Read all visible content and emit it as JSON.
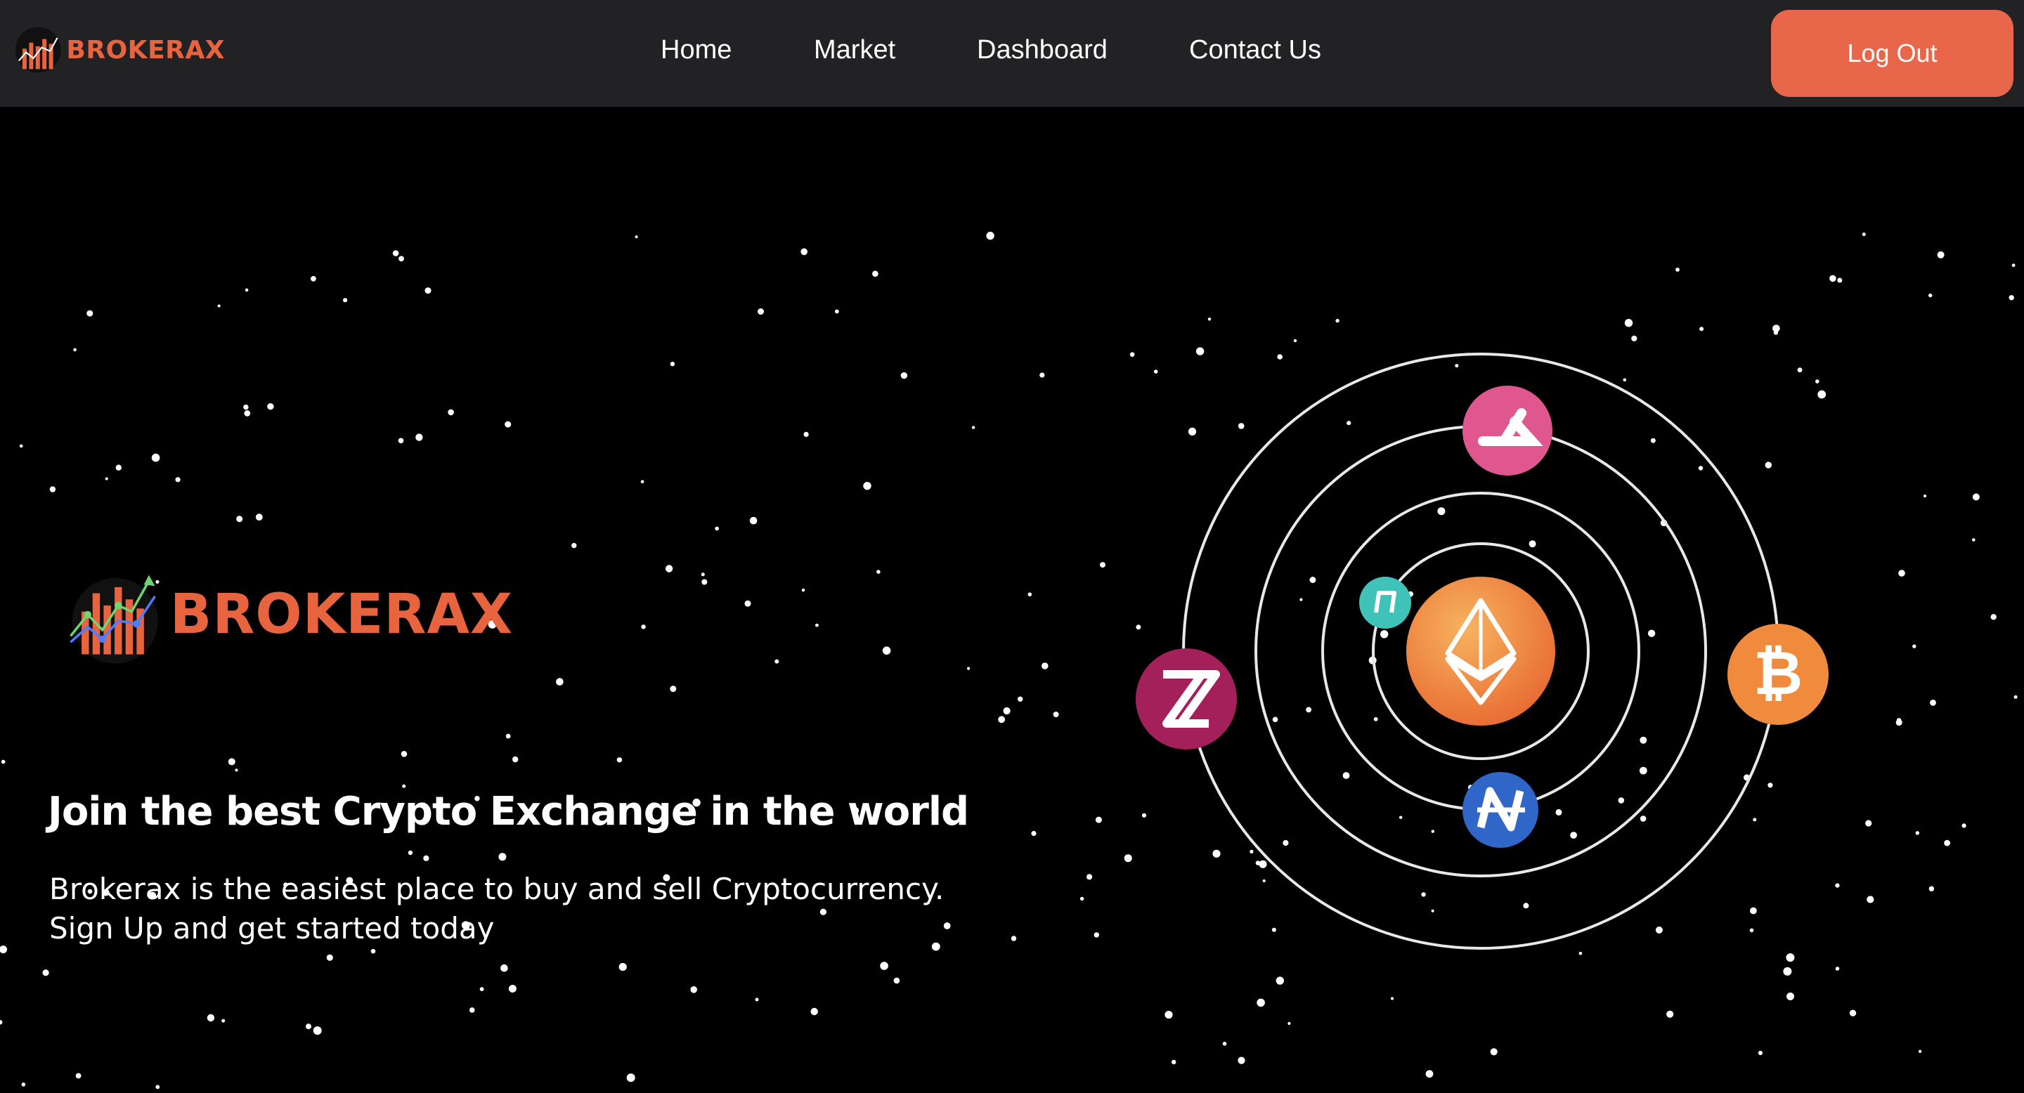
{
  "brand": {
    "name": "BROKERAX"
  },
  "nav": {
    "links": [
      {
        "label": "Home"
      },
      {
        "label": "Market"
      },
      {
        "label": "Dashboard"
      },
      {
        "label": "Contact Us"
      }
    ],
    "logout_label": "Log Out"
  },
  "hero": {
    "title": "Join the best Crypto Exchange in the world",
    "subtitle_line1": "Brokerax is the easiest place to buy and sell Cryptocurrency.",
    "subtitle_line2": "Sign Up and get started today"
  },
  "orbit": {
    "center_icon": "ethereum-icon",
    "coins": [
      {
        "icon": "ark-coin-icon",
        "color": "#e0578f"
      },
      {
        "icon": "dash-coin-icon",
        "color": "#3fc3b8"
      },
      {
        "icon": "zcoin-icon",
        "color": "#a3205a"
      },
      {
        "icon": "bitcoin-icon",
        "color": "#f08a3c"
      },
      {
        "icon": "nano-coin-icon",
        "color": "#2f66c8"
      }
    ]
  },
  "colors": {
    "accent": "#e8643f",
    "nav_bg": "#222224",
    "page_bg": "#000000",
    "button_bg": "#e8664a"
  }
}
